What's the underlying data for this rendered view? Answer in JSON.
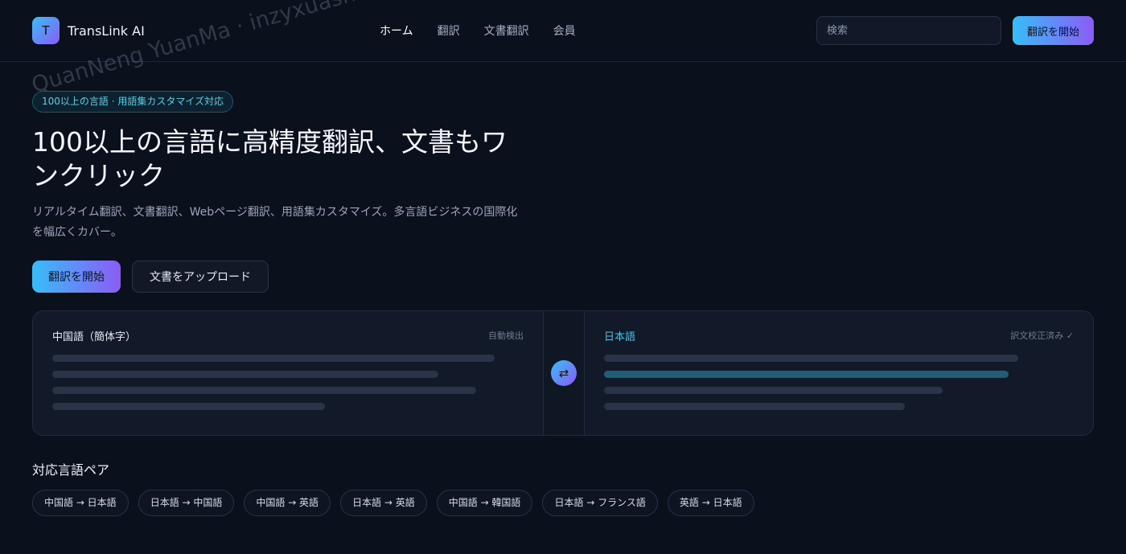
{
  "header": {
    "logo_letter": "T",
    "brand": "TransLink AI",
    "nav": [
      {
        "label": "ホーム",
        "active": true
      },
      {
        "label": "翻訳",
        "active": false
      },
      {
        "label": "文書翻訳",
        "active": false
      },
      {
        "label": "会員",
        "active": false
      }
    ],
    "search_placeholder": "検索",
    "cta_label": "翻訳を開始"
  },
  "watermark": "QuanNeng YuanMa · inzyxuashop.com",
  "hero": {
    "badge": "100以上の言語 · 用語集カスタマイズ対応",
    "title": "100以上の言語に高精度翻訳、文書もワンクリック",
    "subtitle": "リアルタイム翻訳、文書翻訳、Webページ翻訳、用語集カスタマイズ。多言語ビジネスの国際化を幅広くカバー。",
    "primary_button": "翻訳を開始",
    "secondary_button": "文書をアップロード"
  },
  "translator": {
    "source_lang": "中国語（簡体字）",
    "source_status": "自動検出",
    "swap_icon": "⇄",
    "target_lang": "日本語",
    "target_status": "訳文校正済み ✓"
  },
  "pairs": {
    "title": "対応言語ペア",
    "items": [
      "中国語 → 日本語",
      "日本語 → 中国語",
      "中国語 → 英語",
      "日本語 → 英語",
      "中国語 → 韓国語",
      "日本語 → フランス語",
      "英語 → 日本語"
    ]
  },
  "colors": {
    "background": "#0b101d",
    "accent_start": "#38bdf8",
    "accent_end": "#8b5cf6",
    "target_lang": "#48c1e4"
  }
}
